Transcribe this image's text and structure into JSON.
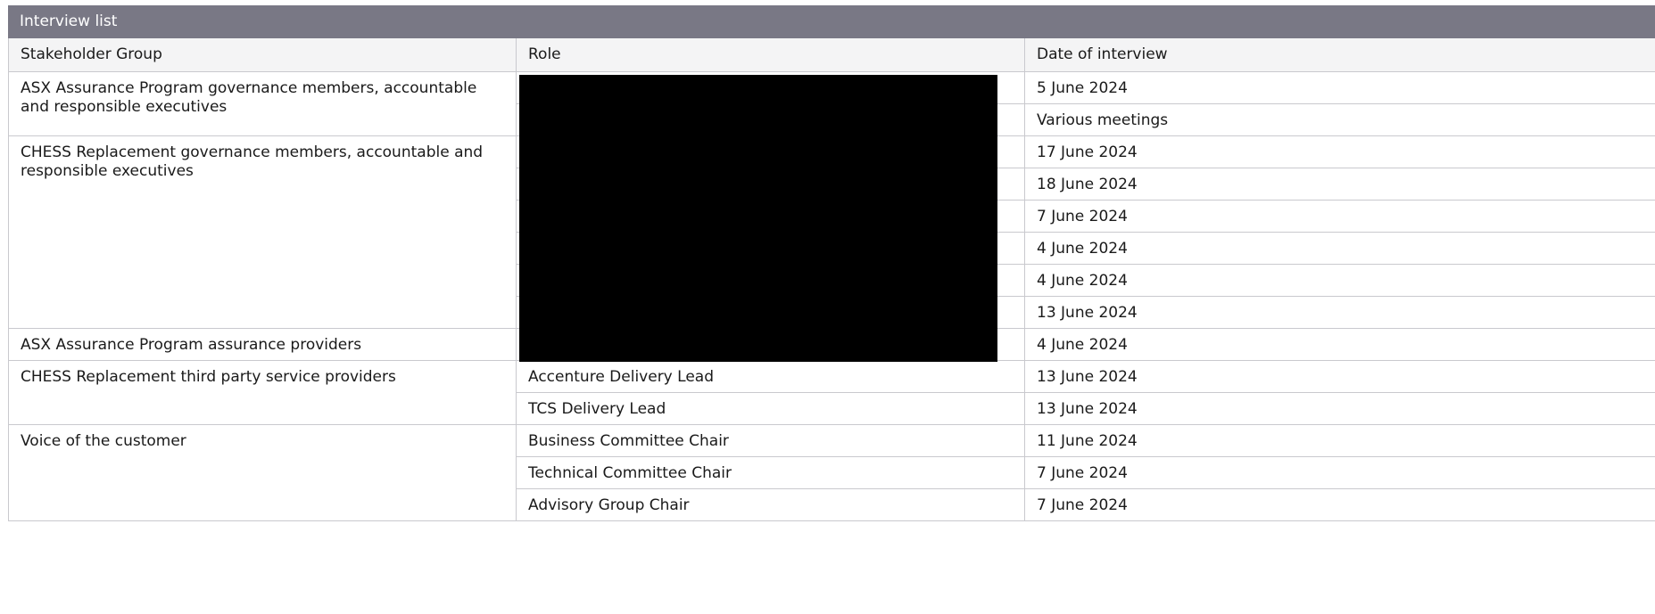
{
  "table": {
    "title": "Interview list",
    "headers": {
      "group": "Stakeholder Group",
      "role": "Role",
      "date": "Date of interview"
    },
    "groups": [
      {
        "label": "ASX Assurance Program governance members, accountable and responsible executives"
      },
      {
        "label": "CHESS Replacement governance members, accountable and responsible executives"
      },
      {
        "label": "ASX Assurance Program assurance providers"
      },
      {
        "label": "CHESS Replacement third party service providers"
      },
      {
        "label": "Voice of the customer"
      }
    ],
    "roles": [
      "",
      "",
      "",
      "",
      "",
      "",
      "",
      "",
      "",
      "Accenture Delivery Lead",
      "TCS Delivery Lead",
      "Business Committee Chair",
      "Technical Committee Chair",
      "Advisory Group Chair"
    ],
    "dates": [
      "5 June 2024",
      "Various meetings",
      "17 June 2024",
      "18 June 2024",
      "7 June 2024",
      "4 June 2024",
      "4 June 2024",
      "13 June 2024",
      "4 June 2024",
      "13 June 2024",
      "13 June 2024",
      "11 June 2024",
      "7 June 2024",
      "7 June 2024"
    ]
  }
}
